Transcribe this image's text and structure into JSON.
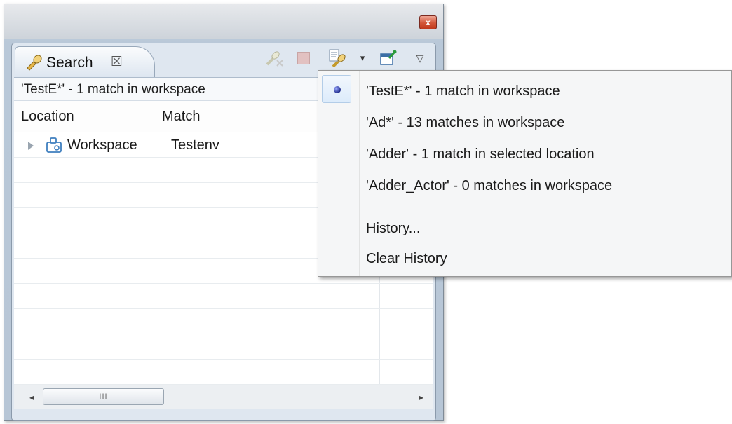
{
  "window": {
    "close_glyph": "x"
  },
  "tab": {
    "title": "Search",
    "close_glyph": "☒"
  },
  "toolbar": {
    "dropdown_glyph": "▾",
    "menu_glyph": "▽",
    "icons": [
      "remove-match-icon",
      "stop-icon",
      "search-history-icon",
      "pin-icon",
      "view-menu-icon"
    ]
  },
  "status": "'TestE*' - 1 match in workspace",
  "table": {
    "columns": [
      "Location",
      "Match"
    ],
    "rows": [
      {
        "location": "Workspace",
        "match": "Testenv"
      }
    ]
  },
  "scrollbar": {
    "left_glyph": "◂",
    "right_glyph": "▸",
    "grip": "III"
  },
  "history_menu": {
    "items": [
      {
        "label": "'TestE*' - 1 match in workspace",
        "selected": true
      },
      {
        "label": "'Ad*' - 13 matches in workspace",
        "selected": false
      },
      {
        "label": "'Adder' - 1 match in selected location",
        "selected": false
      },
      {
        "label": "'Adder_Actor' - 0 matches in workspace",
        "selected": false
      }
    ],
    "actions": [
      {
        "label": "History..."
      },
      {
        "label": "Clear History"
      }
    ]
  },
  "colors": {
    "frame": "#b9c8d8",
    "close_button": "#d25638",
    "menu_background": "#f5f6f7",
    "selection_highlight": "#dcebfb"
  }
}
